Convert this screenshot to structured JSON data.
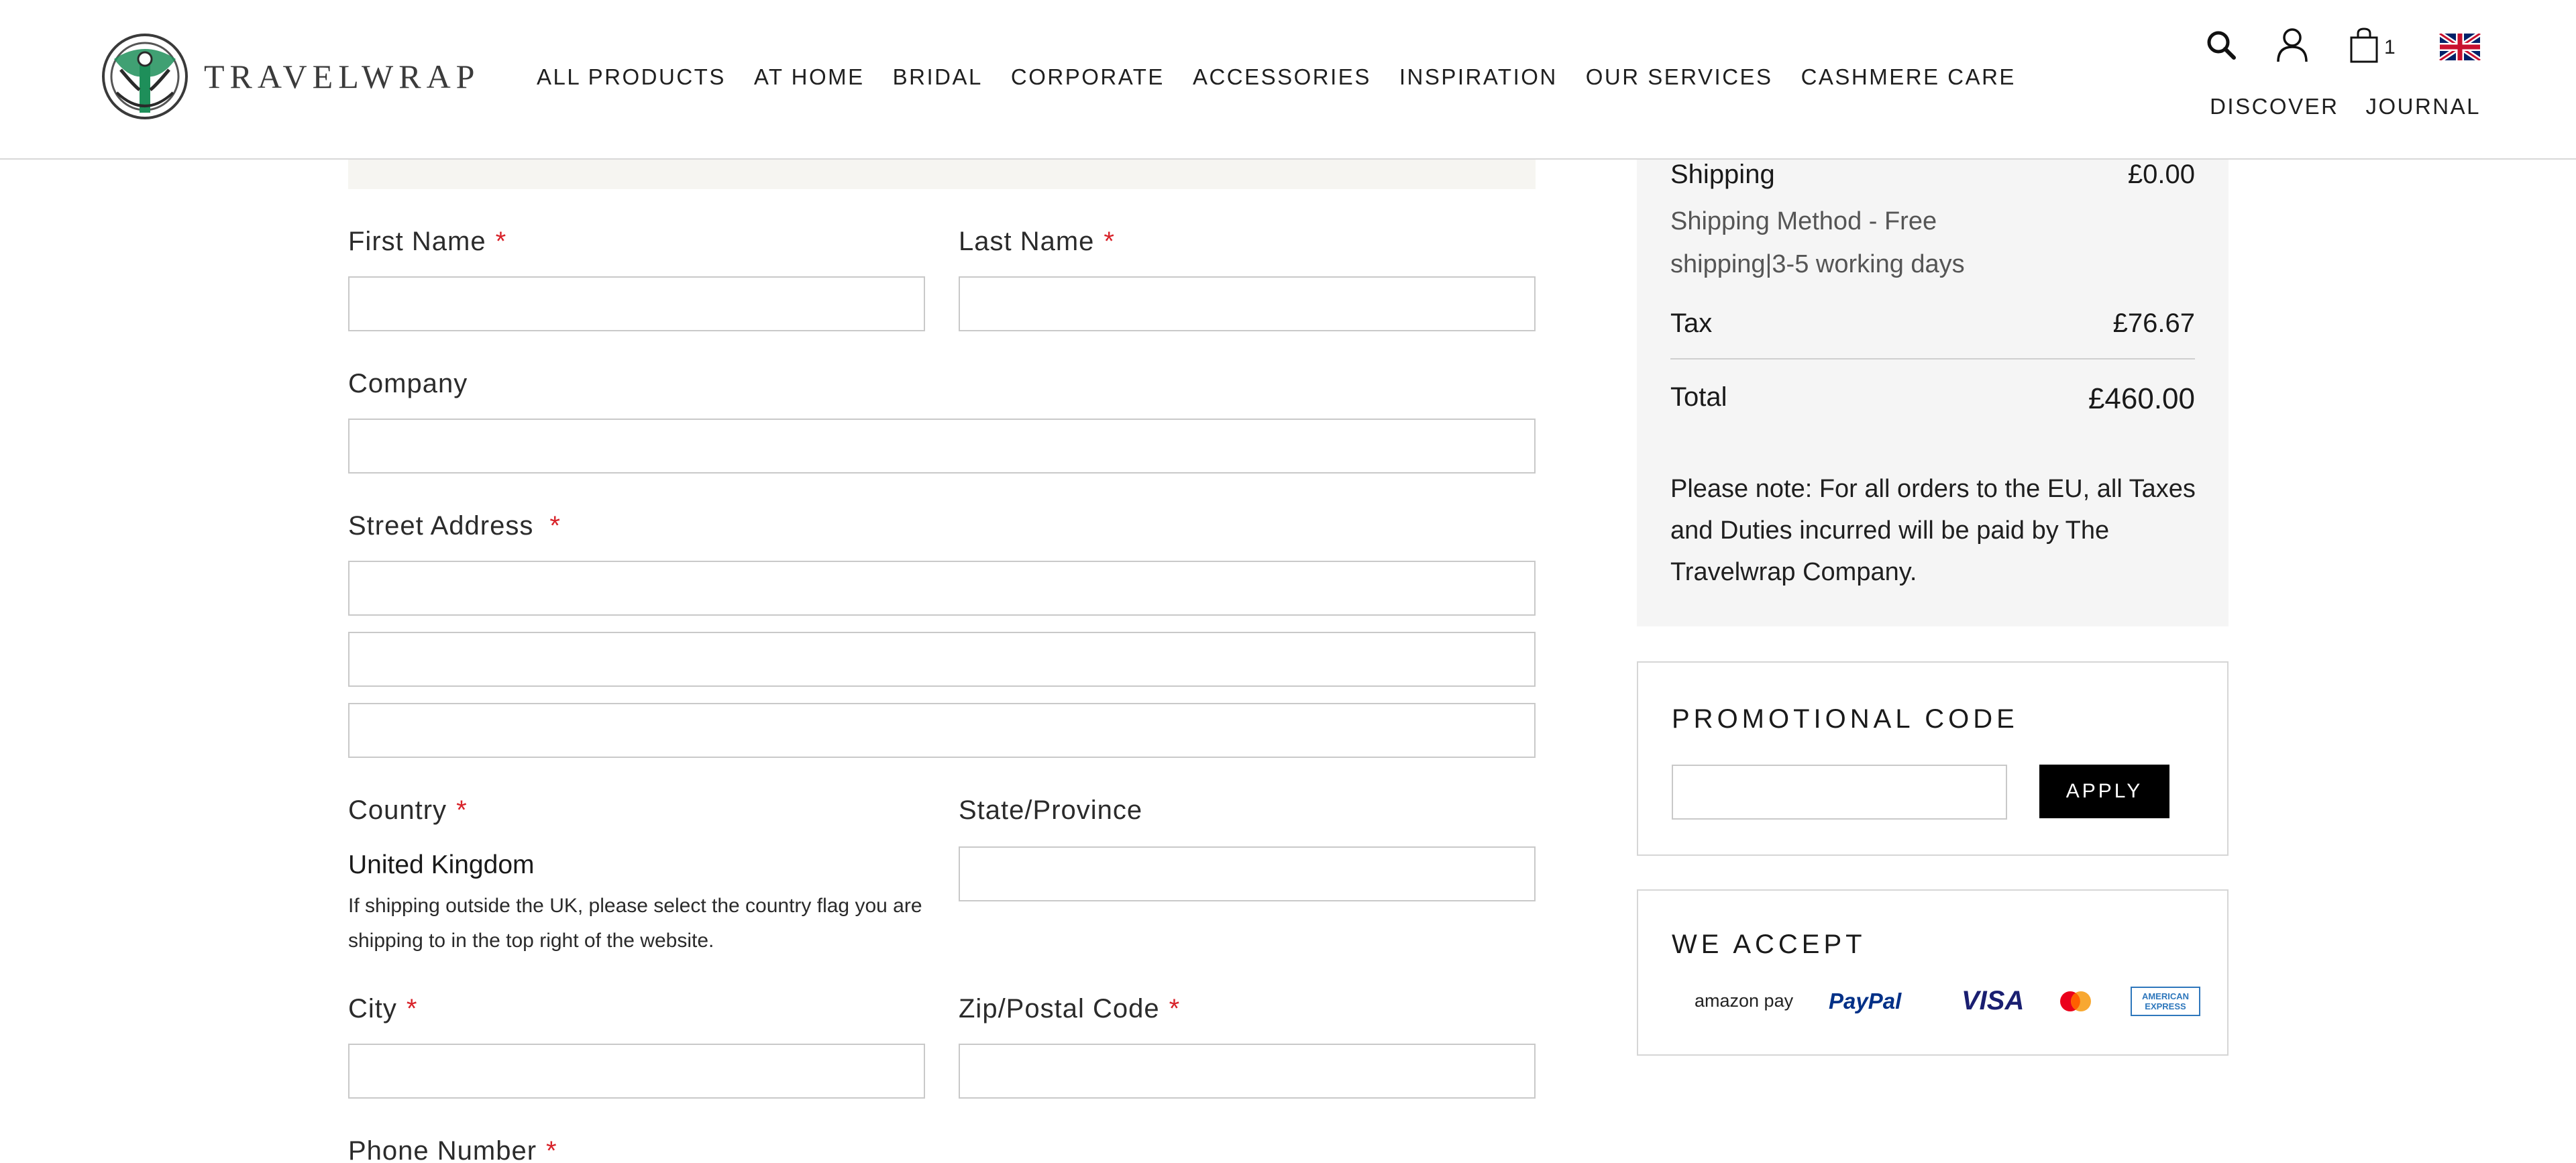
{
  "header": {
    "brand": "TRAVELWRAP",
    "nav": [
      "ALL PRODUCTS",
      "AT HOME",
      "BRIDAL",
      "CORPORATE",
      "ACCESSORIES",
      "INSPIRATION",
      "OUR SERVICES",
      "CASHMERE CARE"
    ],
    "subnav": [
      "DISCOVER",
      "JOURNAL"
    ],
    "cart_count": "1",
    "icons": [
      "search-icon",
      "account-icon",
      "bag-icon",
      "uk-flag-icon"
    ]
  },
  "form": {
    "first_name_label": "First Name",
    "last_name_label": "Last Name",
    "company_label": "Company",
    "street_label": "Street Address",
    "country_label": "Country",
    "country_value": "United Kingdom",
    "country_hint": "If shipping outside the UK, please select the country flag you are shipping to in the top right of the website.",
    "state_label": "State/Province",
    "city_label": "City",
    "zip_label": "Zip/Postal Code",
    "phone_label": "Phone Number",
    "required_mark": "*"
  },
  "summary": {
    "shipping_label": "Shipping",
    "shipping_value": "£0.00",
    "shipping_method": "Shipping Method - Free shipping|3-5 working days",
    "tax_label": "Tax",
    "tax_value": "£76.67",
    "total_label": "Total",
    "total_value": "£460.00",
    "note": "Please note: For all orders to the EU, all Taxes and Duties incurred will be paid by The Travelwrap Company."
  },
  "promo": {
    "title": "PROMOTIONAL CODE",
    "input_value": "",
    "apply_label": "APPLY"
  },
  "payments": {
    "title": "WE ACCEPT",
    "methods": [
      "amazon pay",
      "PayPal",
      "VISA",
      "mastercard",
      "AMERICAN EXPRESS"
    ]
  },
  "colors": {
    "accent_green": "#1e8f5a",
    "required_red": "#d8232a",
    "apply_bg": "#000000",
    "summary_bg": "#f5f5f5"
  }
}
